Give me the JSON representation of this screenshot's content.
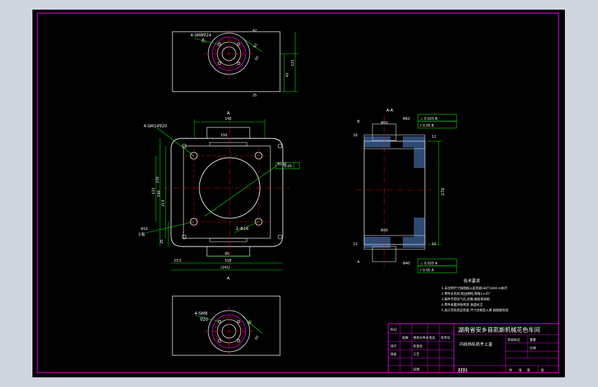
{
  "colors": {
    "background": "#000000",
    "border": "#ff00ff",
    "outline": "#ffffff",
    "centerline": "#ff0000",
    "dimension": "#00ff00",
    "text": "#ffffff",
    "app": "#cfd6df"
  },
  "title_block": {
    "company": "湖南省安乡县凯斯机械花色车间",
    "part_name": "内线挡轧机件上盖",
    "material_label": "材料",
    "row_labels": [
      "标记",
      "处数",
      "分区",
      "更改文件号",
      "签名",
      "年月日",
      "设计",
      "标准化",
      "工艺",
      "审核",
      "批准",
      "日期"
    ],
    "right_labels": [
      "阶段标记",
      "重量",
      "比例",
      "共",
      "张",
      "第",
      "张"
    ],
    "cells": [
      "标记",
      "处数",
      "更改文件号",
      "签名",
      "年月日",
      "设计",
      "标准化",
      "审核",
      "工艺",
      "日期"
    ]
  },
  "section_label": "A-A",
  "view_markers": {
    "top": "A",
    "bottom": "A"
  },
  "top_view": {
    "label1": "4-SM8∇24",
    "label2": "孔",
    "dims": [
      "42",
      "50",
      "50",
      "43",
      "121",
      "25"
    ]
  },
  "main_view": {
    "callouts": [
      "4-SM14∇20",
      "2-Φ16",
      "Φ130",
      "Φ16",
      "工程",
      "0.05"
    ],
    "dims_top": [
      "140",
      "150"
    ],
    "dims_bottom": [
      "80",
      "23.5",
      "158",
      "(241)"
    ],
    "dims_left": [
      "122",
      "190",
      "230",
      "213",
      "25"
    ]
  },
  "section_view": {
    "dims": [
      "Φ50",
      "Φ30",
      "270",
      "16",
      "12",
      "10",
      "12",
      "Φ62",
      "Φ40",
      "A",
      "B"
    ],
    "tolerances": [
      "⊥ 0.025 B",
      "⫽ 0.05 B",
      "⊥ 0.025 A",
      "⫽ 0.05 A"
    ]
  },
  "bottom_view": {
    "label1": "4-SM8",
    "label2": "∇20",
    "dims": [
      "50",
      "30"
    ]
  },
  "tech_notes": {
    "title": "技术要求",
    "lines": [
      "1.未注明尺寸按图纸公差等级GB/T1804-m执行",
      "2.零件去毛刺,锐边倒钝,倒角1×45°",
      "3.铸件不得有气孔,砂眼,缩松等缺陷",
      "4.零件表面涂防锈漆 表面光洁",
      "5.加工完毕后应检查 尺寸合格后入库 按图纸检验"
    ]
  }
}
